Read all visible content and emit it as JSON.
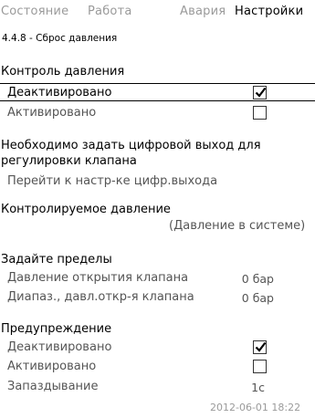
{
  "tabs": [
    "Состояние",
    "Работа",
    "Авария",
    "Настройки"
  ],
  "active_tab": 3,
  "subtitle": "4.4.8 - Сброс давления",
  "pressure_control": {
    "heading": "Контроль давления",
    "options": [
      {
        "label": "Деактивировано",
        "checked": true
      },
      {
        "label": "Активировано",
        "checked": false
      }
    ]
  },
  "digital_output": {
    "note": "Необходимо задать цифровой выход для регулировки клапана",
    "link": "Перейти к настр-ке цифр.выхода"
  },
  "monitored_pressure": {
    "heading": "Контролируемое давление",
    "value": "(Давление в системе)"
  },
  "limits": {
    "heading": "Задайте пределы",
    "rows": [
      {
        "label": "Давление открытия клапана",
        "value": "0 бар"
      },
      {
        "label": "Диапаз., давл.откр-я клапана",
        "value": "0 бар"
      }
    ]
  },
  "warning": {
    "heading": "Предупреждение",
    "options": [
      {
        "label": "Деактивировано",
        "checked": true
      },
      {
        "label": "Активировано",
        "checked": false
      }
    ],
    "delay_label": "Запаздывание",
    "delay_value": "1с"
  },
  "footer_datetime": "2012-06-01 18:22"
}
